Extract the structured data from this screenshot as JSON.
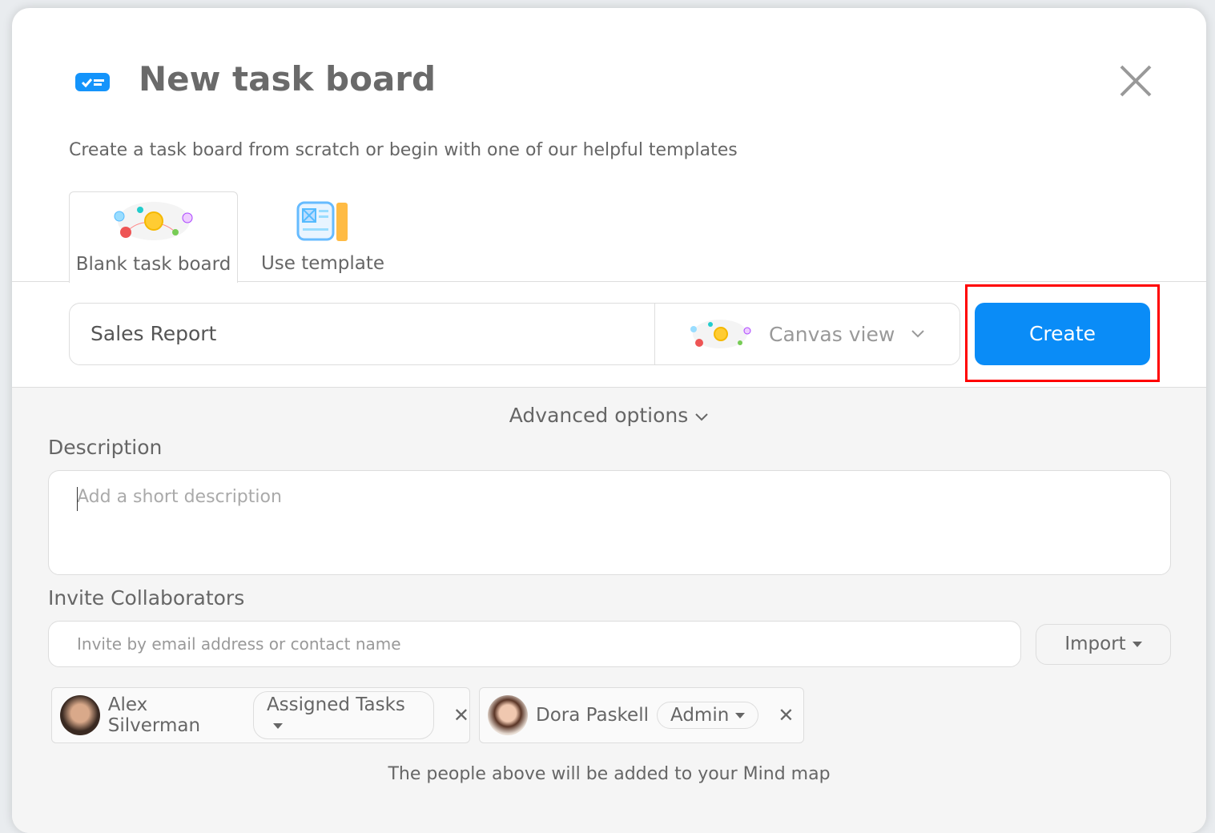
{
  "dialog": {
    "title": "New task board",
    "subtitle": "Create a task board from scratch or begin with one of our helpful templates",
    "close_icon": "close-icon",
    "tabs": [
      {
        "label": "Blank task board",
        "icon": "mind-map-icon",
        "active": true
      },
      {
        "label": "Use template",
        "icon": "template-icon"
      }
    ],
    "board_name": "Sales Report",
    "view": "Canvas view",
    "create_label": "Create",
    "accent": "#0a8cf7"
  },
  "advanced": {
    "label": "Advanced options",
    "description_label": "Description",
    "description_placeholder": "Add a short description",
    "invite_label": "Invite Collaborators",
    "invite_placeholder": "Invite by email address or contact name",
    "import_label": "Import",
    "collaborators": [
      {
        "name": "Alex Silverman",
        "role": "Assigned Tasks"
      },
      {
        "name": "Dora Paskell",
        "role": "Admin"
      }
    ],
    "note": "The people above will be added to your Mind map"
  }
}
